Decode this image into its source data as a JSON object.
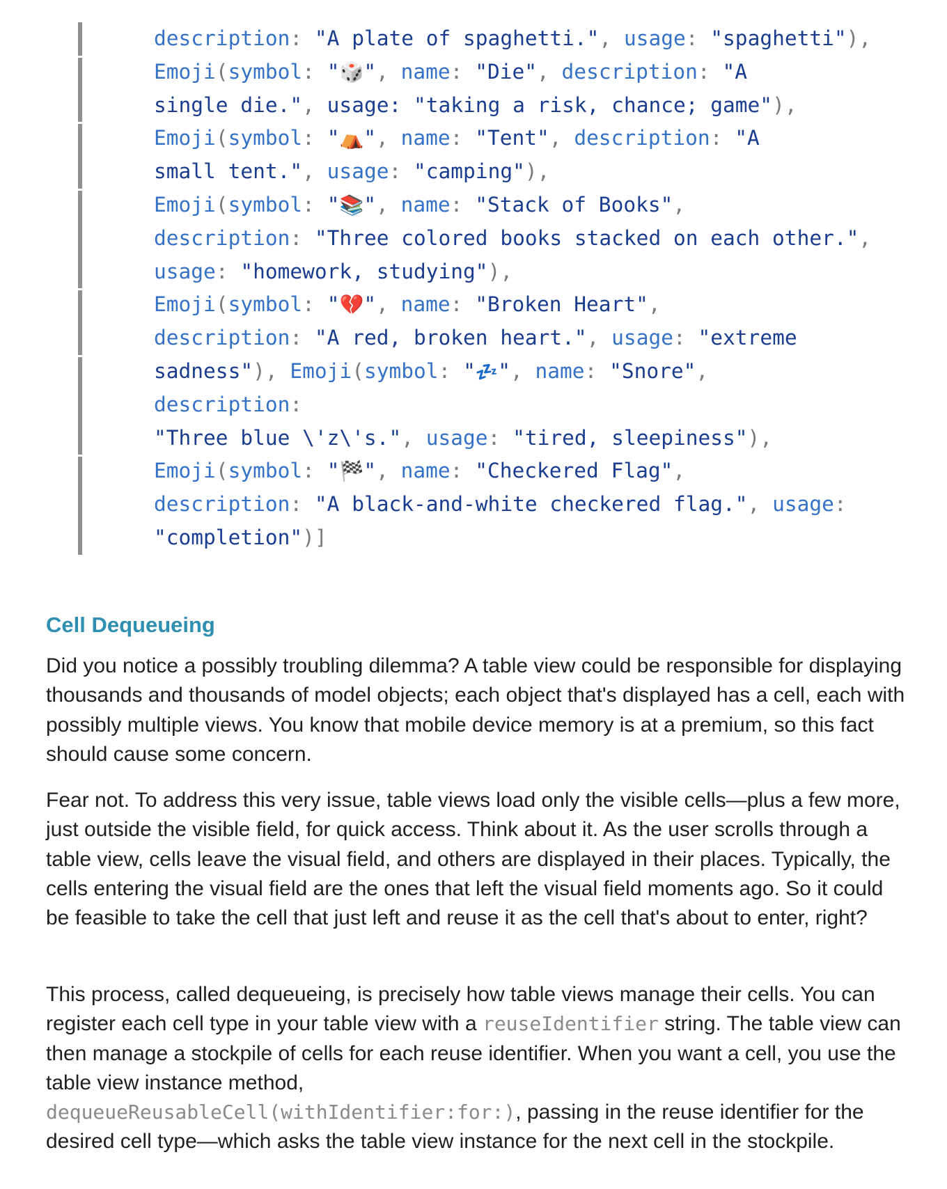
{
  "code": {
    "lines": [
      [
        {
          "t": "description",
          "c": "k"
        },
        {
          "t": ": ",
          "c": "p"
        },
        {
          "t": "\"A plate of spaghetti.\"",
          "c": "s"
        },
        {
          "t": ", ",
          "c": "p"
        },
        {
          "t": "usage",
          "c": "k"
        },
        {
          "t": ": ",
          "c": "p"
        },
        {
          "t": "\"spaghetti\"",
          "c": "s"
        },
        {
          "t": "),",
          "c": "p"
        }
      ],
      [
        {
          "t": "Emoji",
          "c": "k"
        },
        {
          "t": "(",
          "c": "p"
        },
        {
          "t": "symbol",
          "c": "k"
        },
        {
          "t": ": ",
          "c": "p"
        },
        {
          "t": "\"",
          "c": "s"
        },
        {
          "t": "🎲",
          "c": "emo die"
        },
        {
          "t": "\"",
          "c": "s"
        },
        {
          "t": ", ",
          "c": "p"
        },
        {
          "t": "name",
          "c": "k"
        },
        {
          "t": ": ",
          "c": "p"
        },
        {
          "t": "\"Die\"",
          "c": "s"
        },
        {
          "t": ", ",
          "c": "p"
        },
        {
          "t": "description",
          "c": "k"
        },
        {
          "t": ": ",
          "c": "p"
        },
        {
          "t": "\"A",
          "c": "s"
        }
      ],
      [
        {
          "t": "single die.\"",
          "c": "s"
        },
        {
          "t": ", ",
          "c": "p"
        },
        {
          "t": "usage: ",
          "c": "s"
        },
        {
          "t": "\"taking a risk, chance; game\"",
          "c": "s"
        },
        {
          "t": "),",
          "c": "p"
        }
      ],
      [
        {
          "t": "Emoji",
          "c": "k"
        },
        {
          "t": "(",
          "c": "p"
        },
        {
          "t": "symbol",
          "c": "k"
        },
        {
          "t": ": ",
          "c": "p"
        },
        {
          "t": "\"",
          "c": "s"
        },
        {
          "t": "⛺",
          "c": "emo tent"
        },
        {
          "t": "\"",
          "c": "s"
        },
        {
          "t": ", ",
          "c": "p"
        },
        {
          "t": "name",
          "c": "k"
        },
        {
          "t": ": ",
          "c": "p"
        },
        {
          "t": "\"Tent\"",
          "c": "s"
        },
        {
          "t": ", ",
          "c": "p"
        },
        {
          "t": "description",
          "c": "k"
        },
        {
          "t": ": ",
          "c": "p"
        },
        {
          "t": "\"A",
          "c": "s"
        }
      ],
      [
        {
          "t": "small tent.\"",
          "c": "s"
        },
        {
          "t": ", ",
          "c": "p"
        },
        {
          "t": "usage",
          "c": "k"
        },
        {
          "t": ": ",
          "c": "p"
        },
        {
          "t": "\"camping\"",
          "c": "s"
        },
        {
          "t": "),",
          "c": "p"
        }
      ],
      [
        {
          "t": "Emoji",
          "c": "k"
        },
        {
          "t": "(",
          "c": "p"
        },
        {
          "t": "symbol",
          "c": "k"
        },
        {
          "t": ": ",
          "c": "p"
        },
        {
          "t": "\"",
          "c": "s"
        },
        {
          "t": "📚",
          "c": "emo books"
        },
        {
          "t": "\"",
          "c": "s"
        },
        {
          "t": ", ",
          "c": "p"
        },
        {
          "t": "name",
          "c": "k"
        },
        {
          "t": ": ",
          "c": "p"
        },
        {
          "t": "\"Stack of Books\"",
          "c": "s"
        },
        {
          "t": ",",
          "c": "p"
        }
      ],
      [
        {
          "t": "description",
          "c": "k"
        },
        {
          "t": ": ",
          "c": "p"
        },
        {
          "t": "\"Three colored books stacked on each other.\"",
          "c": "s"
        },
        {
          "t": ",",
          "c": "p"
        }
      ],
      [
        {
          "t": "usage",
          "c": "k"
        },
        {
          "t": ": ",
          "c": "p"
        },
        {
          "t": "\"homework, studying\"",
          "c": "s"
        },
        {
          "t": "),",
          "c": "p"
        }
      ],
      [
        {
          "t": "Emoji",
          "c": "k"
        },
        {
          "t": "(",
          "c": "p"
        },
        {
          "t": "symbol",
          "c": "k"
        },
        {
          "t": ": ",
          "c": "p"
        },
        {
          "t": "\"",
          "c": "s"
        },
        {
          "t": "💔",
          "c": "emo heart"
        },
        {
          "t": "\"",
          "c": "s"
        },
        {
          "t": ", ",
          "c": "p"
        },
        {
          "t": "name",
          "c": "k"
        },
        {
          "t": ": ",
          "c": "p"
        },
        {
          "t": "\"Broken Heart\"",
          "c": "s"
        },
        {
          "t": ",",
          "c": "p"
        }
      ],
      [
        {
          "t": "description",
          "c": "k"
        },
        {
          "t": ": ",
          "c": "p"
        },
        {
          "t": "\"A red, broken heart.\"",
          "c": "s"
        },
        {
          "t": ", ",
          "c": "p"
        },
        {
          "t": "usage",
          "c": "k"
        },
        {
          "t": ": ",
          "c": "p"
        },
        {
          "t": "\"extreme",
          "c": "s"
        }
      ],
      [
        {
          "t": "sadness\"",
          "c": "s"
        },
        {
          "t": "), ",
          "c": "p"
        },
        {
          "t": "Emoji",
          "c": "k"
        },
        {
          "t": "(",
          "c": "p"
        },
        {
          "t": "symbol",
          "c": "k"
        },
        {
          "t": ": ",
          "c": "p"
        },
        {
          "t": "\"",
          "c": "s"
        },
        {
          "t": "💤",
          "c": "emo zzz"
        },
        {
          "t": "\"",
          "c": "s"
        },
        {
          "t": ", ",
          "c": "p"
        },
        {
          "t": "name",
          "c": "k"
        },
        {
          "t": ": ",
          "c": "p"
        },
        {
          "t": "\"Snore\"",
          "c": "s"
        },
        {
          "t": ",",
          "c": "p"
        }
      ],
      [
        {
          "t": "description",
          "c": "k"
        },
        {
          "t": ":",
          "c": "p"
        }
      ],
      [
        {
          "t": "\"Three blue \\'z\\'s.\"",
          "c": "s"
        },
        {
          "t": ", ",
          "c": "p"
        },
        {
          "t": "usage",
          "c": "k"
        },
        {
          "t": ": ",
          "c": "p"
        },
        {
          "t": "\"tired, sleepiness\"",
          "c": "s"
        },
        {
          "t": "),",
          "c": "p"
        }
      ],
      [
        {
          "t": "Emoji",
          "c": "k"
        },
        {
          "t": "(",
          "c": "p"
        },
        {
          "t": "symbol",
          "c": "k"
        },
        {
          "t": ": ",
          "c": "p"
        },
        {
          "t": "\"",
          "c": "s"
        },
        {
          "t": "🏁",
          "c": "emo flag"
        },
        {
          "t": "\"",
          "c": "s"
        },
        {
          "t": ", ",
          "c": "p"
        },
        {
          "t": "name",
          "c": "k"
        },
        {
          "t": ": ",
          "c": "p"
        },
        {
          "t": "\"Checkered Flag\"",
          "c": "s"
        },
        {
          "t": ",",
          "c": "p"
        }
      ],
      [
        {
          "t": "description",
          "c": "k"
        },
        {
          "t": ": ",
          "c": "p"
        },
        {
          "t": "\"A black-and-white checkered flag.\"",
          "c": "s"
        },
        {
          "t": ", ",
          "c": "p"
        },
        {
          "t": "usage",
          "c": "k"
        },
        {
          "t": ":",
          "c": "p"
        }
      ],
      [
        {
          "t": "\"completion\"",
          "c": "s"
        },
        {
          "t": ")]",
          "c": "p"
        }
      ]
    ]
  },
  "section": {
    "heading": "Cell Dequeueing",
    "p1": "Did you notice a possibly troubling dilemma? A table view could be responsible for displaying thousands and thousands of model objects; each object that's displayed has a cell, each with possibly multiple views. You know that mobile device memory is at a premium, so this fact should cause some concern.",
    "p2": "Fear not. To address this very issue, table views load only the visible cells—plus a few more, just outside the visible field, for quick access. Think about it. As the user scrolls through a table view, cells leave the visual field, and others are displayed in their places. Typically, the cells entering the visual field are the ones that left the visual field moments ago. So it could be feasible to take the cell that just left and reuse it as the cell that's about to enter, right?",
    "p3_a": "This process, called dequeueing, is precisely how table views manage their cells. You can register each cell type in your table view with a ",
    "p3_code1": "reuseIdentifier",
    "p3_b": " string. The table view can then manage a stockpile of cells for each reuse identifier. When you want a cell, you use the table view instance method, ",
    "p3_code2": "dequeueReusableCell(withIdentifier:for:)",
    "p3_c": ", passing in the reuse identifier for the desired cell type—which asks the table view instance for the next cell in the stockpile."
  }
}
